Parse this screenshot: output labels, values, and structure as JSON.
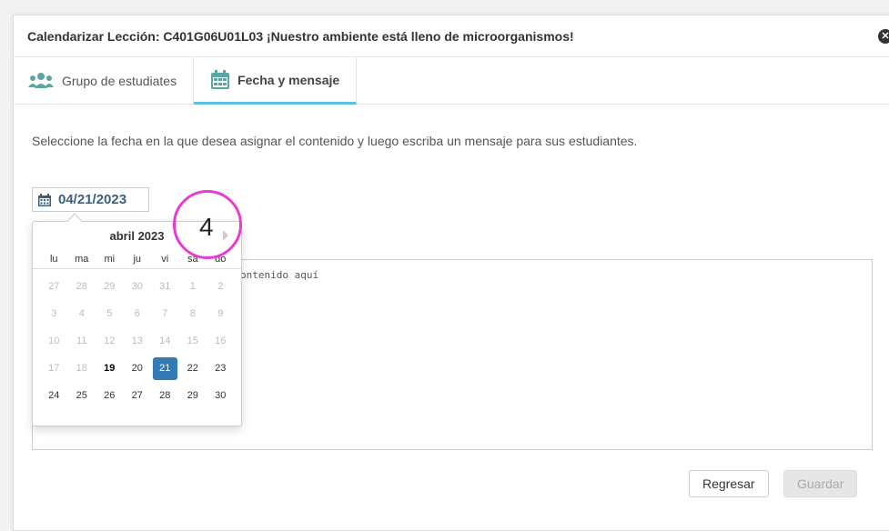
{
  "modal": {
    "title": "Calendarizar Lección: C401G06U01L03 ¡Nuestro ambiente está lleno de microorganismos!",
    "close_icon": "close-circle-icon"
  },
  "tabs": [
    {
      "label": "Grupo de estudiates",
      "icon": "users-icon",
      "active": false
    },
    {
      "label": "Fecha y mensaje",
      "icon": "calendar-icon",
      "active": true
    }
  ],
  "instructions": "Seleccione la fecha en la que desea asignar el contenido y luego escriba un mensaje para sus estudiantes.",
  "date_field": {
    "value": "04/21/2023",
    "icon": "calendar-icon"
  },
  "message": {
    "placeholder_visible": "ontenido aquí"
  },
  "calendar": {
    "month_label": "abril 2023",
    "weekdays": [
      "lu",
      "ma",
      "mi",
      "ju",
      "vi",
      "sá",
      "do"
    ],
    "weeks": [
      [
        "27",
        "28",
        "29",
        "30",
        "31",
        "1",
        "2"
      ],
      [
        "3",
        "4",
        "5",
        "6",
        "7",
        "8",
        "9"
      ],
      [
        "10",
        "11",
        "12",
        "13",
        "14",
        "15",
        "16"
      ],
      [
        "17",
        "18",
        "19",
        "20",
        "21",
        "22",
        "23"
      ],
      [
        "24",
        "25",
        "26",
        "27",
        "28",
        "29",
        "30"
      ]
    ],
    "today": "19",
    "selected": "21"
  },
  "annotation": {
    "number": "4",
    "color": "#e83dd0"
  },
  "buttons": {
    "back": "Regresar",
    "save": "Guardar"
  },
  "colors": {
    "accent": "#5bc0de",
    "selected": "#337ab7",
    "icon": "#5aa6a0"
  }
}
